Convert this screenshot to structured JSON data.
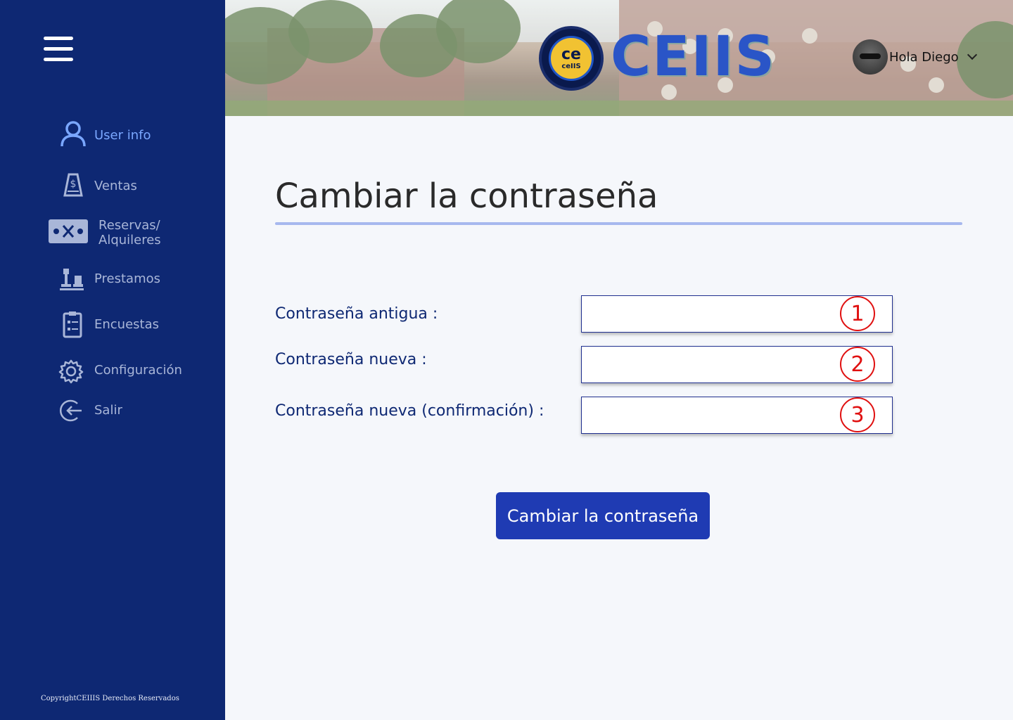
{
  "sidebar": {
    "items": [
      {
        "label": "User info",
        "icon": "user-icon"
      },
      {
        "label": "Ventas",
        "icon": "sales-icon"
      },
      {
        "label": "Reservas/\nAlquileres",
        "icon": "ticket-icon"
      },
      {
        "label": "Prestamos",
        "icon": "chess-icon"
      },
      {
        "label": "Encuestas",
        "icon": "clipboard-icon"
      },
      {
        "label": "Configuración",
        "icon": "gear-icon"
      },
      {
        "label": "Salir",
        "icon": "logout-icon"
      }
    ],
    "copyright": "CopyrightCEIIIS Derechos Reservados"
  },
  "header": {
    "brand": "CEIIS",
    "logo_text_top": "ce",
    "logo_text_bottom": "ceIIS",
    "greeting": "Hola Diego"
  },
  "main": {
    "title": "Cambiar la contraseña",
    "fields": [
      {
        "label": "Contraseña antigua :",
        "value": "",
        "marker": "1"
      },
      {
        "label": "Contraseña nueva :",
        "value": "",
        "marker": "2"
      },
      {
        "label": "Contraseña nueva (confirmación) :",
        "value": "",
        "marker": "3"
      }
    ],
    "submit_label": "Cambiar la contraseña"
  },
  "colors": {
    "sidebar_bg": "#0e2873",
    "active_item": "#7aa7ff",
    "button_bg": "#1f3bb3",
    "marker": "#e01010"
  }
}
